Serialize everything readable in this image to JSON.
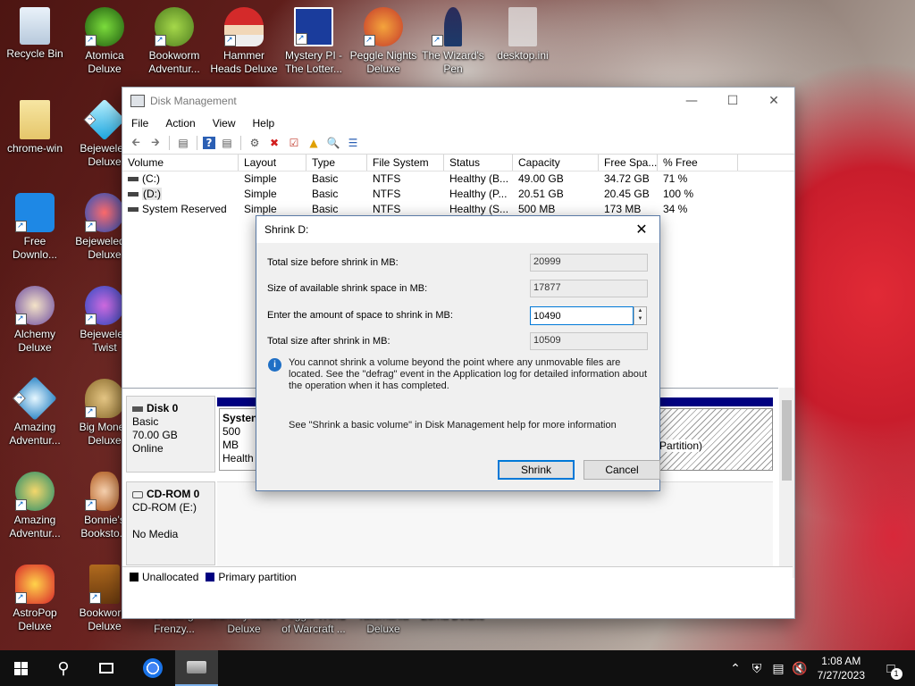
{
  "desktop": {
    "icons": [
      {
        "label": "Recycle Bin",
        "icon": "recycle-bin-icon"
      },
      {
        "label": "Atomica Deluxe",
        "icon": "atomica-icon"
      },
      {
        "label": "Bookworm Adventur...",
        "icon": "bookworm-icon"
      },
      {
        "label": "Hammer Heads Deluxe",
        "icon": "gnome-icon"
      },
      {
        "label": "Mystery PI - The Lotter...",
        "icon": "mystery-pi-icon"
      },
      {
        "label": "Peggle Nights Deluxe",
        "icon": "peggle-icon"
      },
      {
        "label": "The Wizard's Pen",
        "icon": "wizard-icon"
      },
      {
        "label": "desktop.ini",
        "icon": "file-icon"
      },
      {
        "label": "chrome-win",
        "icon": "folder-icon"
      },
      {
        "label": "Bejeweled Deluxe",
        "icon": "gem-icon"
      },
      {
        "label": "Free Downlo...",
        "icon": "download-icon"
      },
      {
        "label": "Bejeweled 2 Deluxe",
        "icon": "gem-2-icon"
      },
      {
        "label": "Alchemy Deluxe",
        "icon": "alchemy-icon"
      },
      {
        "label": "Bejeweled Twist",
        "icon": "gem-twist-icon"
      },
      {
        "label": "Amazing Adventur...",
        "icon": "amazing-icon"
      },
      {
        "label": "Big Money Deluxe",
        "icon": "money-icon"
      },
      {
        "label": "Amazing Adventur...",
        "icon": "amazing-icon"
      },
      {
        "label": "Bonnie's Booksto...",
        "icon": "bonnie-icon"
      },
      {
        "label": "AstroPop Deluxe",
        "icon": "astropop-icon"
      },
      {
        "label": "Bookworm Deluxe",
        "icon": "bookworm-deluxe-icon"
      },
      {
        "label": "Feeding Frenzy...",
        "icon": "feeding-frenzy-icon"
      },
      {
        "label": "Mummy Maze Deluxe",
        "icon": "mummy-icon"
      },
      {
        "label": "Peggle World of Warcraft ...",
        "icon": "peggle-wow-icon"
      },
      {
        "label": "Talismania Deluxe",
        "icon": "talismania-icon"
      },
      {
        "label": "Zuma Deluxe",
        "icon": "zuma-icon"
      }
    ]
  },
  "window": {
    "title": "Disk Management",
    "menu": [
      "File",
      "Action",
      "View",
      "Help"
    ],
    "columns": [
      "Volume",
      "Layout",
      "Type",
      "File System",
      "Status",
      "Capacity",
      "Free Spa...",
      "% Free"
    ],
    "volumes": [
      {
        "volume": "(C:)",
        "layout": "Simple",
        "type": "Basic",
        "fs": "NTFS",
        "status": "Healthy (B...",
        "capacity": "49.00 GB",
        "free": "34.72 GB",
        "pct": "71 %"
      },
      {
        "volume": "(D:)",
        "layout": "Simple",
        "type": "Basic",
        "fs": "NTFS",
        "status": "Healthy (P...",
        "capacity": "20.51 GB",
        "free": "20.45 GB",
        "pct": "100 %"
      },
      {
        "volume": "System Reserved",
        "layout": "Simple",
        "type": "Basic",
        "fs": "NTFS",
        "status": "Healthy (S...",
        "capacity": "500 MB",
        "free": "173 MB",
        "pct": "34 %"
      }
    ],
    "disks": [
      {
        "name": "Disk 0",
        "type": "Basic",
        "size": "70.00 GB",
        "state": "Online"
      },
      {
        "name": "CD-ROM 0",
        "type": "CD-ROM (E:)",
        "size": "",
        "state": "No Media"
      }
    ],
    "partition_snippets": {
      "sys_name": "Systen",
      "sys_size": "500 MB",
      "sys_status": "Health",
      "d_status_tail": "artition)"
    },
    "legend": {
      "unallocated": "Unallocated",
      "primary": "Primary partition"
    },
    "colors": {
      "unallocated": "#000000",
      "primary": "#000080",
      "disk_bar": "#000080"
    }
  },
  "dialog": {
    "title": "Shrink D:",
    "rows": [
      {
        "label": "Total size before shrink in MB:",
        "value": "20999"
      },
      {
        "label": "Size of available shrink space in MB:",
        "value": "17877"
      },
      {
        "label": "Enter the amount of space to shrink in MB:",
        "value": "10490"
      },
      {
        "label": "Total size after shrink in MB:",
        "value": "10509"
      }
    ],
    "info": "You cannot shrink a volume beyond the point where any unmovable files are located. See the \"defrag\" event in the Application log for detailed information about the operation when it has completed.",
    "more": "See \"Shrink a basic volume\" in Disk Management help for more information",
    "shrink_label": "Shrink",
    "cancel_label": "Cancel"
  },
  "taskbar": {
    "time": "1:08 AM",
    "date": "7/27/2023",
    "notification_count": "1"
  }
}
